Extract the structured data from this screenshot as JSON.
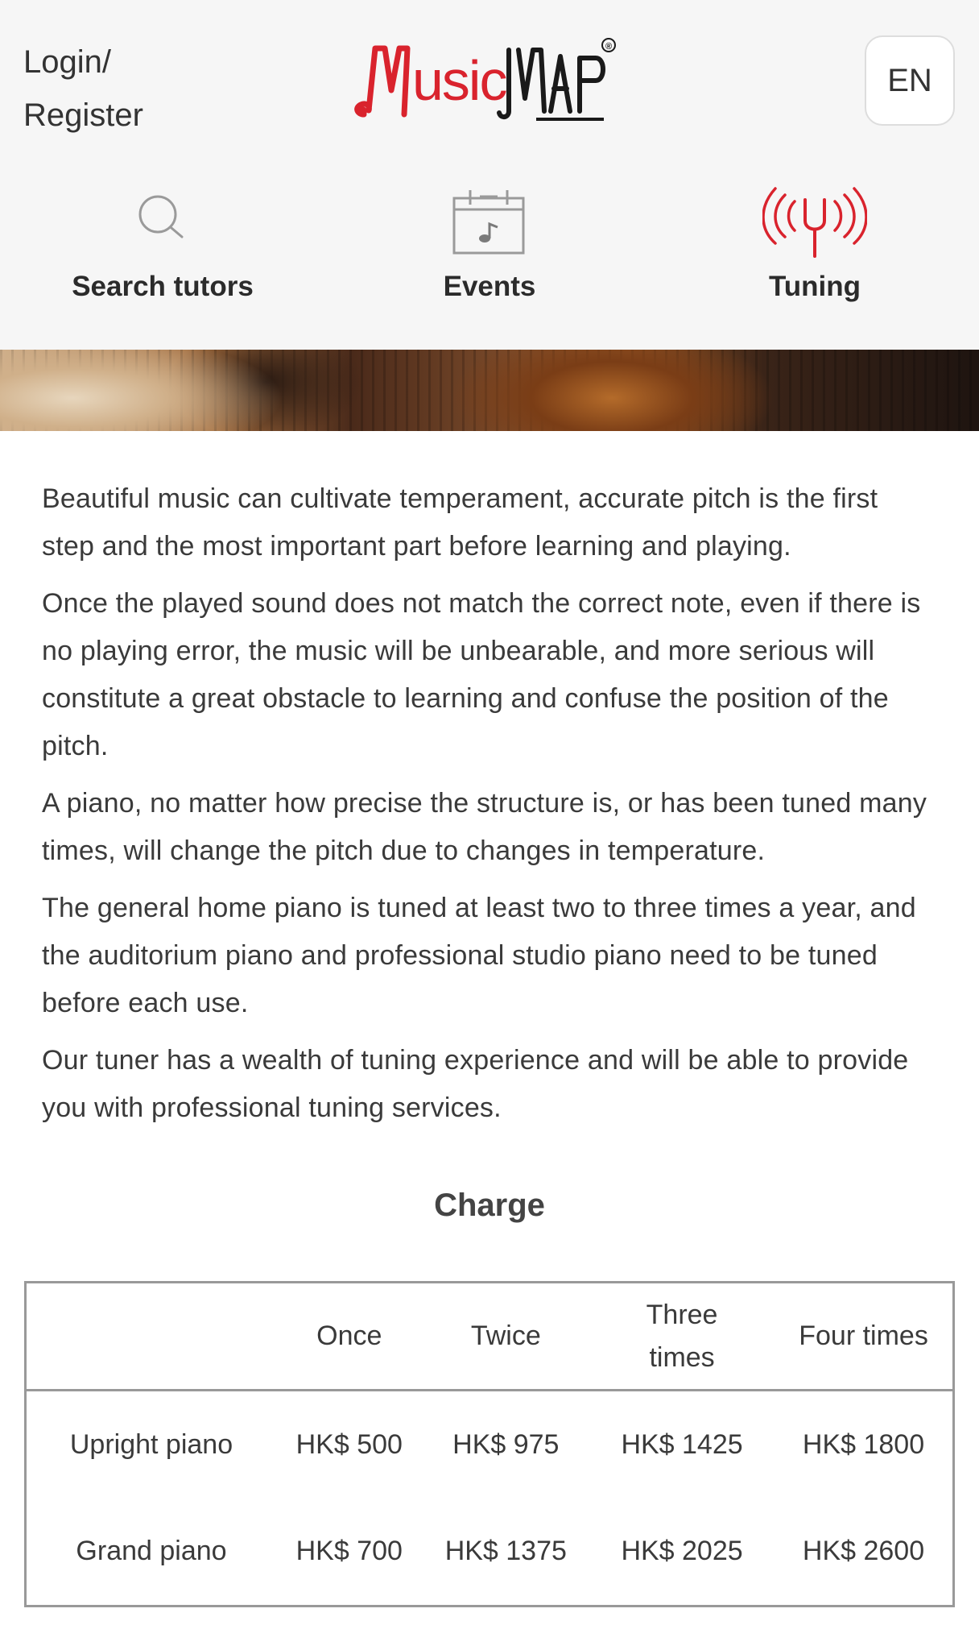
{
  "header": {
    "login_register": "Login/\nRegister",
    "language": "EN",
    "logo_text": "MusicMap",
    "logo_mark": "®"
  },
  "nav": {
    "items": [
      {
        "label": "Search tutors",
        "icon": "search-icon",
        "active": false
      },
      {
        "label": "Events",
        "icon": "calendar-music-icon",
        "active": false
      },
      {
        "label": "Tuning",
        "icon": "tuning-fork-icon",
        "active": true
      }
    ]
  },
  "colors": {
    "brand_red": "#d9232d",
    "icon_gray": "#9a9a9a",
    "text": "#3a3a3a"
  },
  "content": {
    "paragraphs": [
      "Beautiful music can cultivate temperament, accurate pitch is the first step and the most important part before learning and playing.",
      "Once the played sound does not match the correct note, even if there is no playing error, the music will be unbearable, and more serious will constitute a great obstacle to learning and confuse the position of the pitch.",
      "A piano, no matter how precise the structure is, or has been tuned many times, will change the pitch due to changes in temperature.",
      "The general home piano is tuned at least two to three times a year, and the auditorium piano and professional studio piano need to be tuned before each use.",
      "Our tuner has a wealth of tuning experience and will be able to provide you with professional tuning services."
    ]
  },
  "charge": {
    "title": "Charge",
    "headers": [
      "",
      "Once",
      "Twice",
      "Three times",
      "Four times"
    ],
    "rows": [
      [
        "Upright piano",
        "HK$ 500",
        "HK$ 975",
        "HK$ 1425",
        "HK$ 1800"
      ],
      [
        "Grand piano",
        "HK$ 700",
        "HK$ 1375",
        "HK$ 2025",
        "HK$ 2600"
      ]
    ]
  }
}
